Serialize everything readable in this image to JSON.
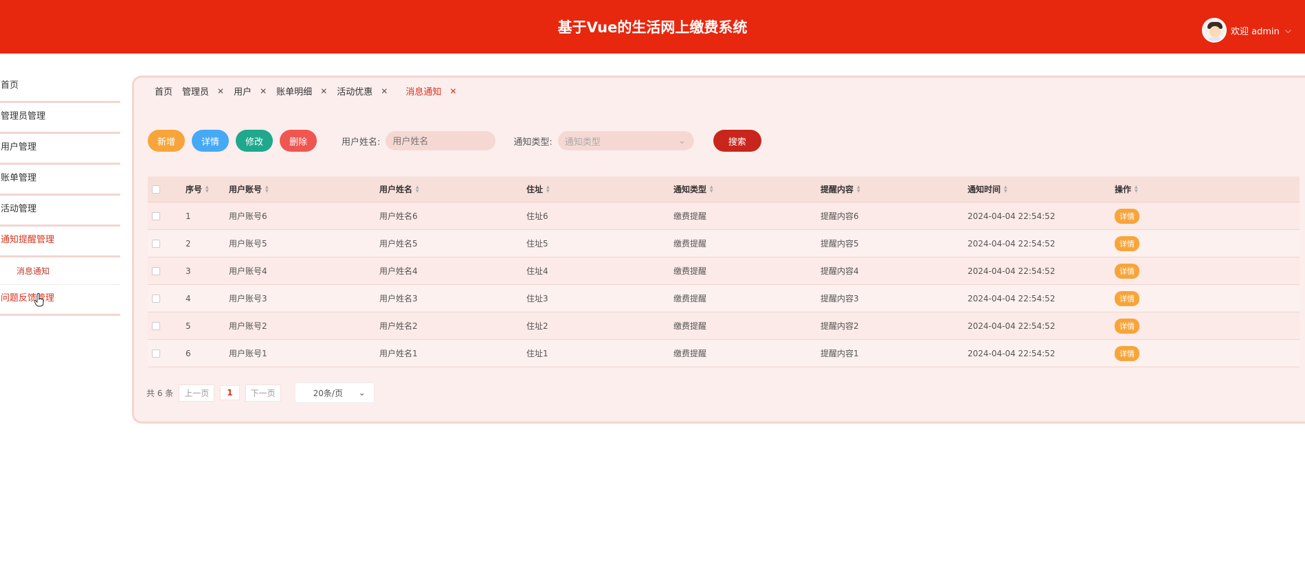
{
  "app": {
    "title": "基于Vue的生活网上缴费系统"
  },
  "user": {
    "greeting": "欢迎 admin",
    "chevron": "⌵"
  },
  "sidebar": {
    "items": [
      {
        "label": "首页"
      },
      {
        "label": "管理员管理"
      },
      {
        "label": "用户管理"
      },
      {
        "label": "账单管理"
      },
      {
        "label": "活动管理"
      },
      {
        "label": "通知提醒管理"
      },
      {
        "label": "问题反馈管理"
      }
    ],
    "subitem": {
      "label": "消息通知"
    }
  },
  "tabs": [
    {
      "label": "首页",
      "close": ""
    },
    {
      "label": "管理员",
      "close": "✕"
    },
    {
      "label": "用户",
      "close": "✕"
    },
    {
      "label": "账单明细",
      "close": "✕"
    },
    {
      "label": "活动优惠",
      "close": "✕"
    },
    {
      "label": "消息通知",
      "close": "✕"
    }
  ],
  "toolbar": {
    "add": "新增",
    "detail": "详情",
    "edit": "修改",
    "delete": "删除",
    "name_label": "用户姓名:",
    "name_placeholder": "用户姓名",
    "type_label": "通知类型:",
    "type_placeholder": "通知类型",
    "search": "搜索"
  },
  "table": {
    "headers": [
      "序号",
      "用户账号",
      "用户姓名",
      "住址",
      "通知类型",
      "提醒内容",
      "通知时间",
      "操作"
    ],
    "rows": [
      [
        "1",
        "用户账号6",
        "用户姓名6",
        "住址6",
        "缴费提醒",
        "提醒内容6",
        "2024-04-04 22:54:52",
        "详情"
      ],
      [
        "2",
        "用户账号5",
        "用户姓名5",
        "住址5",
        "缴费提醒",
        "提醒内容5",
        "2024-04-04 22:54:52",
        "详情"
      ],
      [
        "3",
        "用户账号4",
        "用户姓名4",
        "住址4",
        "缴费提醒",
        "提醒内容4",
        "2024-04-04 22:54:52",
        "详情"
      ],
      [
        "4",
        "用户账号3",
        "用户姓名3",
        "住址3",
        "缴费提醒",
        "提醒内容3",
        "2024-04-04 22:54:52",
        "详情"
      ],
      [
        "5",
        "用户账号2",
        "用户姓名2",
        "住址2",
        "缴费提醒",
        "提醒内容2",
        "2024-04-04 22:54:52",
        "详情"
      ],
      [
        "6",
        "用户账号1",
        "用户姓名1",
        "住址1",
        "缴费提醒",
        "提醒内容1",
        "2024-04-04 22:54:52",
        "详情"
      ]
    ]
  },
  "pager": {
    "total": "共 6 条",
    "prev": "上一页",
    "current": "1",
    "next": "下一页",
    "size": "20条/页"
  },
  "colors": {
    "brand": "#e8270f",
    "accent": "#d9321c",
    "orange": "#f7a53a",
    "blue": "#46a9f5",
    "green": "#1fa88d",
    "red": "#ef5650"
  }
}
